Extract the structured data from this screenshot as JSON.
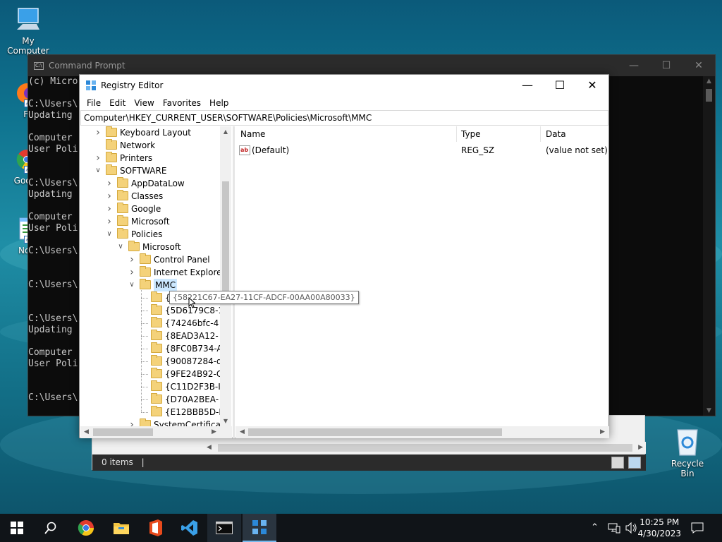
{
  "desktop": {
    "icons": [
      {
        "label": "My Computer"
      },
      {
        "label": "Fire"
      },
      {
        "label": "Goo Chr"
      },
      {
        "label": "Notep"
      }
    ],
    "recycle_bin": "Recycle Bin"
  },
  "cmd": {
    "title": "Command Prompt",
    "lines": [
      "(c) Micro",
      "",
      "C:\\Users\\",
      "Updating",
      "",
      "Computer",
      "User Poli",
      "",
      "",
      "C:\\Users\\",
      "Updating",
      "",
      "Computer",
      "User Poli",
      "",
      "C:\\Users\\",
      "",
      "",
      "C:\\Users\\",
      "",
      "",
      "C:\\Users\\",
      "Updating",
      "",
      "Computer",
      "User Poli",
      "",
      "",
      "C:\\Users\\"
    ]
  },
  "explorer": {
    "status": "0 items"
  },
  "regedit": {
    "title": "Registry Editor",
    "menu": [
      "File",
      "Edit",
      "View",
      "Favorites",
      "Help"
    ],
    "address": "Computer\\HKEY_CURRENT_USER\\SOFTWARE\\Policies\\Microsoft\\MMC",
    "tree": [
      {
        "label": "Keyboard Layout",
        "depth": 0,
        "chev": ">"
      },
      {
        "label": "Network",
        "depth": 0,
        "chev": ""
      },
      {
        "label": "Printers",
        "depth": 0,
        "chev": ">"
      },
      {
        "label": "SOFTWARE",
        "depth": 0,
        "chev": "v"
      },
      {
        "label": "AppDataLow",
        "depth": 1,
        "chev": ">"
      },
      {
        "label": "Classes",
        "depth": 1,
        "chev": ">"
      },
      {
        "label": "Google",
        "depth": 1,
        "chev": ">"
      },
      {
        "label": "Microsoft",
        "depth": 1,
        "chev": ">"
      },
      {
        "label": "Policies",
        "depth": 1,
        "chev": "v"
      },
      {
        "label": "Microsoft",
        "depth": 2,
        "chev": "v"
      },
      {
        "label": "Control Panel",
        "depth": 3,
        "chev": ">"
      },
      {
        "label": "Internet Explore",
        "depth": 3,
        "chev": ">"
      },
      {
        "label": "MMC",
        "depth": 3,
        "chev": "v",
        "selected": true
      },
      {
        "label": "{58221C67-EA27-11CF-ADCF-00AA00A80033}",
        "depth": 4,
        "chev": ""
      },
      {
        "label": "{5D6179C8-1",
        "depth": 4,
        "chev": ""
      },
      {
        "label": "{74246bfc-4",
        "depth": 4,
        "chev": ""
      },
      {
        "label": "{8EAD3A12-",
        "depth": 4,
        "chev": ""
      },
      {
        "label": "{8FC0B734-A",
        "depth": 4,
        "chev": ""
      },
      {
        "label": "{90087284-d",
        "depth": 4,
        "chev": ""
      },
      {
        "label": "{9FE24B92-C",
        "depth": 4,
        "chev": ""
      },
      {
        "label": "{C11D2F3B-I",
        "depth": 4,
        "chev": ""
      },
      {
        "label": "{D70A2BEA-",
        "depth": 4,
        "chev": ""
      },
      {
        "label": "{E12BBB5D-I",
        "depth": 4,
        "chev": ""
      },
      {
        "label": "SystemCertifica",
        "depth": 3,
        "chev": ">"
      }
    ],
    "columns": {
      "name": "Name",
      "type": "Type",
      "data": "Data"
    },
    "values": [
      {
        "name": "(Default)",
        "type": "REG_SZ",
        "data": "(value not set)"
      }
    ],
    "tooltip": "{58221C67-EA27-11CF-ADCF-00AA00A80033}"
  },
  "taskbar": {
    "time": "10:25 PM",
    "date": "4/30/2023"
  }
}
